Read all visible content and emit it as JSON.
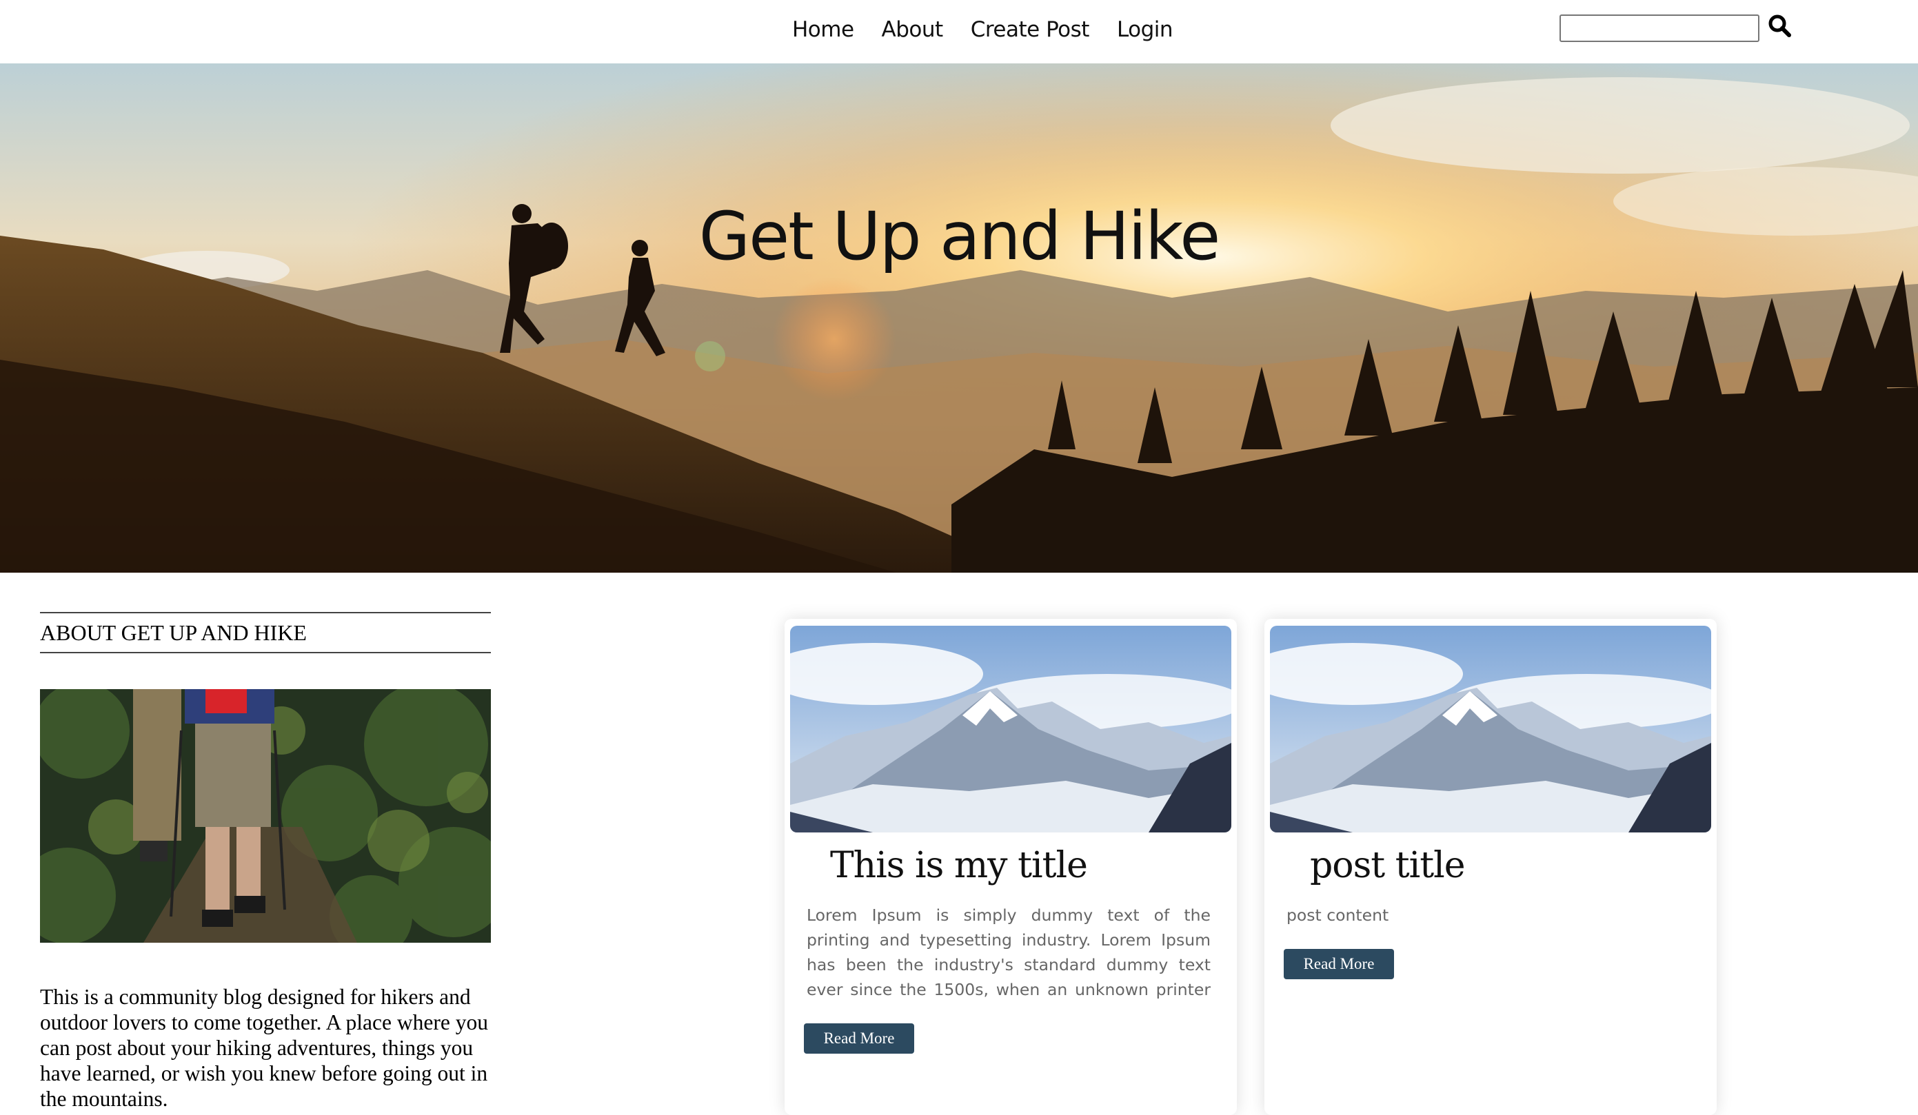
{
  "nav": {
    "links": [
      "Home",
      "About",
      "Create Post",
      "Login"
    ],
    "search_placeholder": "",
    "search_icon": "search-icon"
  },
  "hero": {
    "title": "Get Up and Hike"
  },
  "sidebar": {
    "heading": "ABOUT GET UP AND HIKE",
    "description": "This is a community blog designed for hikers and outdoor lovers to come together. A place where you can post about your hiking adventures, things you have learned, or wish you knew before going out in the mountains."
  },
  "posts": [
    {
      "title": "This is my title",
      "content": "Lorem Ipsum is simply dummy text of the printing and typesetting industry. Lorem Ipsum has been the industry's standard dummy text ever since the 1500s, when an unknown printer took a galley ...",
      "button": "Read More"
    },
    {
      "title": "post title",
      "content": "post content",
      "button": "Read More"
    }
  ],
  "colors": {
    "button_bg": "#2c4a60",
    "button_text": "#ffffff",
    "text_muted": "#666666"
  }
}
